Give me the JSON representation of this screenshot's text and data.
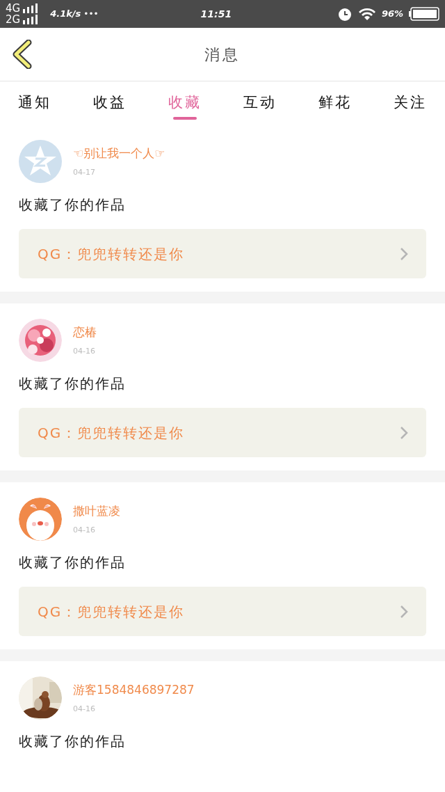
{
  "status_bar": {
    "network_1": "4G",
    "network_2": "2G",
    "speed": "4.1k/s",
    "more": "•••",
    "time": "11:51",
    "battery": "96%"
  },
  "header": {
    "title": "消息"
  },
  "tabs": [
    {
      "label": "通知",
      "selected": false
    },
    {
      "label": "收益",
      "selected": false
    },
    {
      "label": "收藏",
      "selected": true
    },
    {
      "label": "互动",
      "selected": false
    },
    {
      "label": "鲜花",
      "selected": false
    },
    {
      "label": "关注",
      "selected": false
    }
  ],
  "messages": [
    {
      "avatar": {
        "kind": "default"
      },
      "name": "☜别让我一个人☞",
      "date": "04-17",
      "text": "收藏了你的作品",
      "work": "QG：兜兜转转还是你"
    },
    {
      "name": "恋椿",
      "date": "04-16",
      "text": "收藏了你的作品",
      "work": "QG：兜兜转转还是你"
    },
    {
      "name": "撒叶蓝凌",
      "date": "04-16",
      "text": "收藏了你的作品",
      "work": "QG：兜兜转转还是你"
    },
    {
      "name": "游客1584846897287",
      "date": "04-16",
      "text": "收藏了你的作品"
    }
  ]
}
